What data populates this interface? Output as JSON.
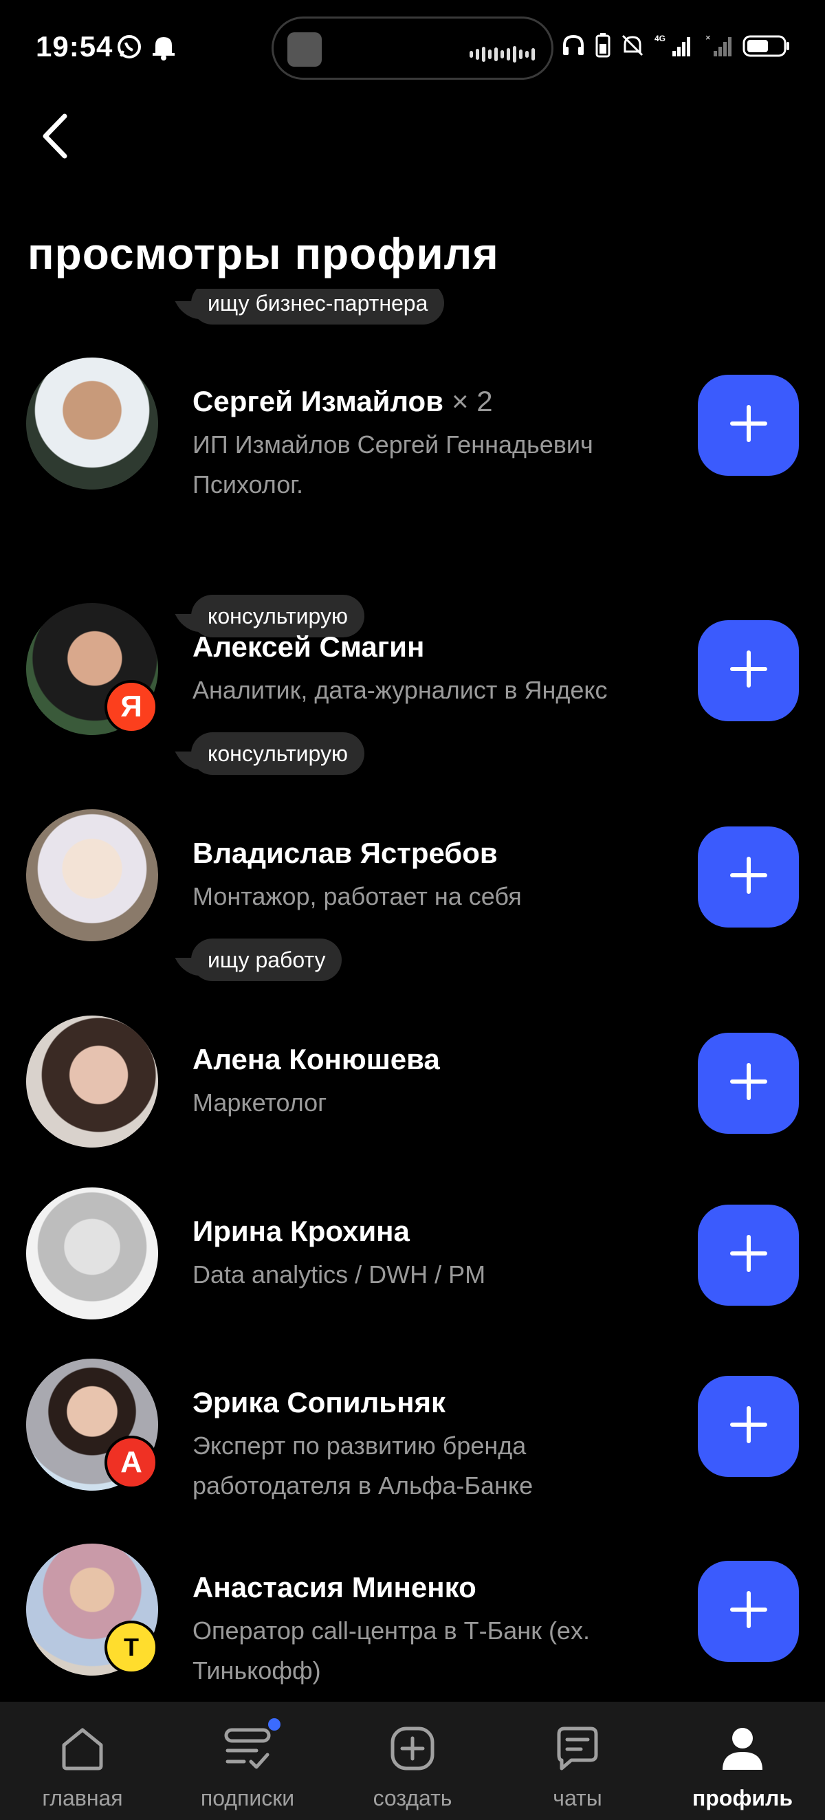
{
  "status_bar": {
    "time": "19:54",
    "icons_left": [
      "whatsapp-icon",
      "bell-icon"
    ],
    "icons_right": [
      "headphones-icon",
      "battery-saver-icon",
      "muted-bell-icon",
      "signal-4g-icon",
      "signal-no-sim-icon",
      "battery-icon"
    ]
  },
  "header": {
    "back_icon": "chevron-left-icon",
    "title": "просмотры профиля",
    "partial_tag": "ищу бизнес-партнера"
  },
  "viewers": [
    {
      "name": "Сергей Измайлов",
      "count": "× 2",
      "desc": "ИП Измайлов Сергей Геннадьевич Психолог.",
      "tag": "консультирую",
      "badge": ""
    },
    {
      "name": "Алексей Смагин",
      "count": "",
      "desc": "Аналитик, дата-журналист в Яндекс",
      "tag": "консультирую",
      "badge": "Я"
    },
    {
      "name": "Владислав Ястребов",
      "count": "",
      "desc": "Монтажор, работает на себя",
      "tag": "ищу работу",
      "badge": ""
    },
    {
      "name": "Алена Конюшева",
      "count": "",
      "desc": "Маркетолог",
      "tag": "",
      "badge": ""
    },
    {
      "name": "Ирина Крохина",
      "count": "",
      "desc": "Data analytics / DWH / PM",
      "tag": "",
      "badge": ""
    },
    {
      "name": "Эрика Сопильняк",
      "count": "",
      "desc": "Эксперт по развитию бренда работодателя в Альфа-Банке",
      "tag": "",
      "badge": "А"
    },
    {
      "name": "Анастасия Миненко",
      "count": "",
      "desc": "Оператор call-центра в Т-Банк (ex. Тинькофф)",
      "tag": "",
      "badge": "Т"
    }
  ],
  "colors": {
    "accent": "#3b5bfd",
    "background": "#000000",
    "tag_bg": "#2b2b2b",
    "secondary_text": "#9a9a9a",
    "yandex": "#fc3f1d",
    "alfa": "#ef3124",
    "tbank": "#ffdd2d"
  },
  "tab_bar": {
    "tabs": [
      {
        "label": "главная",
        "icon": "home-icon"
      },
      {
        "label": "подписки",
        "icon": "subscriptions-icon"
      },
      {
        "label": "создать",
        "icon": "plus-square-icon"
      },
      {
        "label": "чаты",
        "icon": "chat-icon"
      },
      {
        "label": "профиль",
        "icon": "user-icon"
      }
    ],
    "active": "профиль"
  }
}
